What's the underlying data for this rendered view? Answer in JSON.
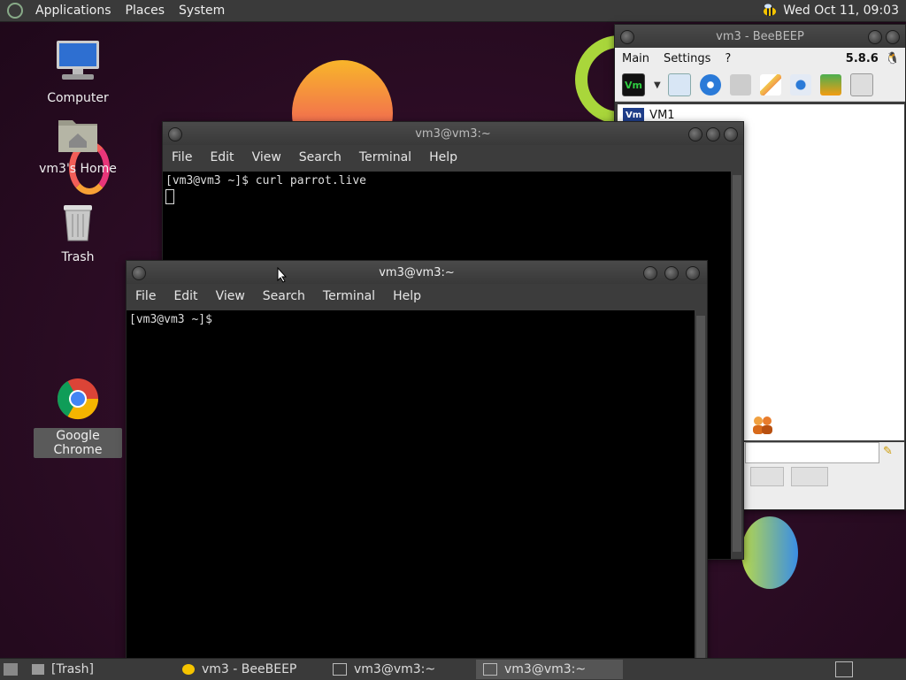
{
  "top_panel": {
    "menus": [
      "Applications",
      "Places",
      "System"
    ],
    "clock": "Wed Oct 11, 09:03"
  },
  "desktop_icons": {
    "computer": "Computer",
    "home": "vm3's Home",
    "trash": "Trash",
    "chrome": "Google Chrome"
  },
  "beebeep": {
    "title": "vm3 - BeeBEEP",
    "menu": [
      "Main",
      "Settings",
      "?"
    ],
    "version": "5.8.6",
    "vm_badge": "Vm",
    "user": "VM1"
  },
  "terminal_back": {
    "title": "vm3@vm3:~",
    "menu": [
      "File",
      "Edit",
      "View",
      "Search",
      "Terminal",
      "Help"
    ],
    "line1": "[vm3@vm3 ~]$ curl parrot.live"
  },
  "terminal_front": {
    "title": "vm3@vm3:~",
    "menu": [
      "File",
      "Edit",
      "View",
      "Search",
      "Terminal",
      "Help"
    ],
    "line1": "[vm3@vm3 ~]$"
  },
  "taskbar": {
    "items": [
      "[Trash]",
      "vm3 - BeeBEEP",
      "vm3@vm3:~",
      "vm3@vm3:~"
    ]
  },
  "colors": {
    "accent_orange": "#f7a135",
    "accent_pink": "#e8367a",
    "terminal_bg": "#000000"
  }
}
